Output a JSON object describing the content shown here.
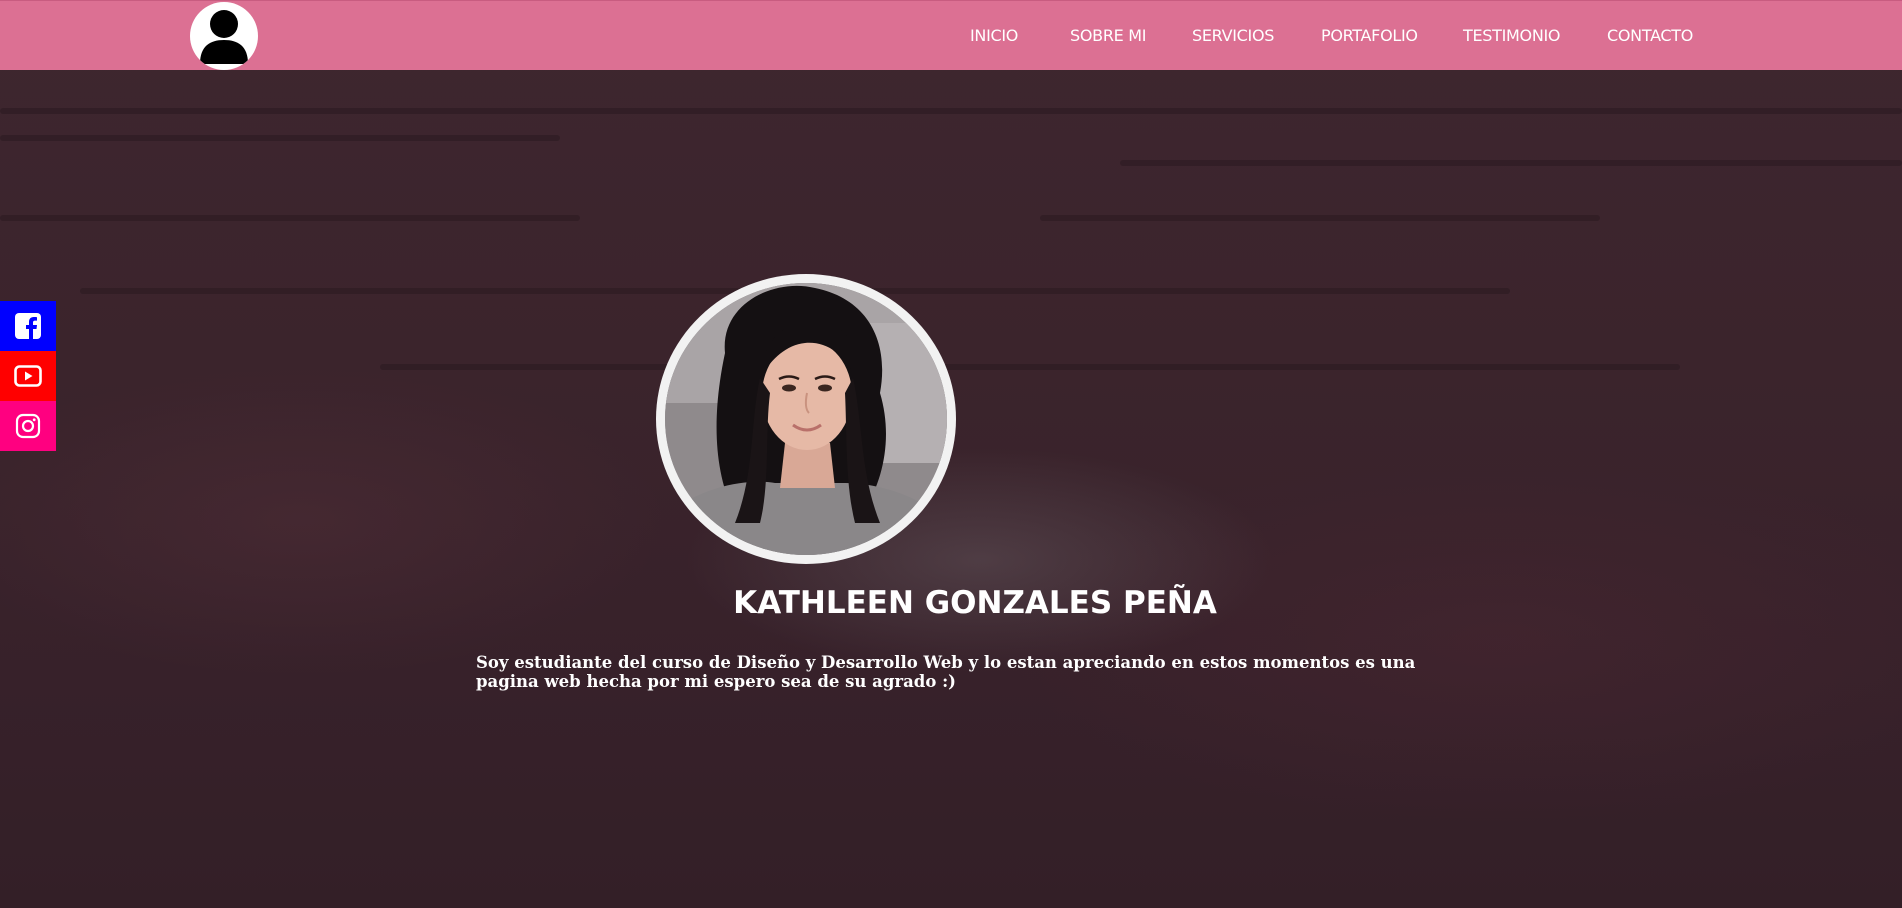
{
  "header": {
    "logo_icon": "user-avatar-icon",
    "nav": [
      {
        "label": "INICIO"
      },
      {
        "label": "SOBRE MI"
      },
      {
        "label": "SERVICIOS"
      },
      {
        "label": "PORTAFOLIO"
      },
      {
        "label": "TESTIMONIO"
      },
      {
        "label": "CONTACTO"
      }
    ]
  },
  "social": [
    {
      "name": "Facebook",
      "icon": "facebook-icon",
      "color": "#0000ff"
    },
    {
      "name": "YouTube",
      "icon": "youtube-icon",
      "color": "#ff0000"
    },
    {
      "name": "Instagram",
      "icon": "instagram-icon",
      "color": "#ff0080"
    }
  ],
  "profile": {
    "name": "KATHLEEN GONZALES PEÑA",
    "bio": "Soy estudiante del curso de Diseño y Desarrollo Web y lo estan apreciando en estos momentos es una pagina web hecha por mi espero sea de su agrado :)"
  },
  "colors": {
    "header_bg": "#dc7093",
    "page_bg": "#3b242c",
    "text": "#ffffff"
  }
}
